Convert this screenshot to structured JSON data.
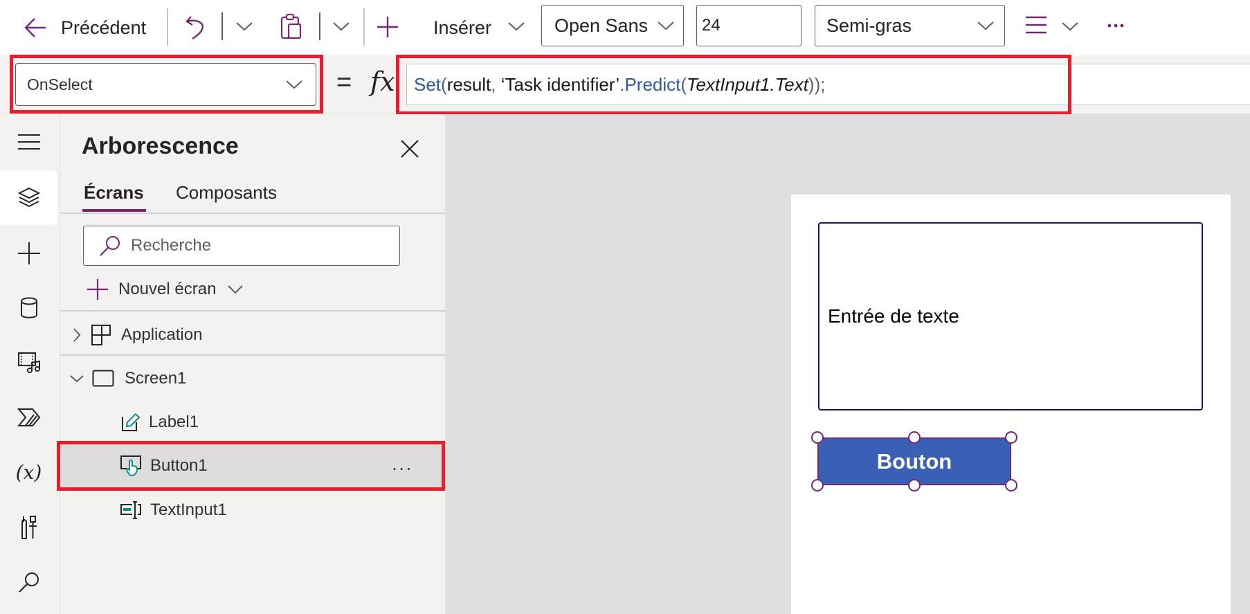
{
  "toolbar": {
    "back_label": "Précédent",
    "insert_label": "Insérer",
    "font_family": "Open Sans",
    "font_size": "24",
    "font_weight": "Semi-gras",
    "icons": {
      "back": "arrow-left-icon",
      "undo": "undo-icon",
      "paste": "clipboard-icon",
      "insert": "plus-icon",
      "align": "align-lines-icon",
      "more": "ellipsis-icon"
    }
  },
  "formula_bar": {
    "property": "OnSelect",
    "equals": "=",
    "fx": "fx",
    "formula_tokens": [
      {
        "text": "Set",
        "kind": "fn"
      },
      {
        "text": "(",
        "kind": "punct"
      },
      {
        "text": "result",
        "kind": "plain"
      },
      {
        "text": ", ",
        "kind": "punct"
      },
      {
        "text": "‘Task identifier’",
        "kind": "plain"
      },
      {
        "text": ".",
        "kind": "punct"
      },
      {
        "text": "Predict",
        "kind": "fn"
      },
      {
        "text": "(",
        "kind": "punct"
      },
      {
        "text": "TextInput1.Text",
        "kind": "param"
      },
      {
        "text": "));",
        "kind": "punct"
      }
    ],
    "formula_text": "Set(result, ‘Task identifier’.Predict(TextInput1.Text));"
  },
  "left_rail": {
    "items": [
      {
        "name": "menu",
        "icon": "hamburger-icon"
      },
      {
        "name": "tree-view",
        "icon": "layers-icon",
        "active": true
      },
      {
        "name": "insert",
        "icon": "plus-icon"
      },
      {
        "name": "data",
        "icon": "database-icon"
      },
      {
        "name": "media",
        "icon": "media-icon"
      },
      {
        "name": "power-automate",
        "icon": "power-automate-icon"
      },
      {
        "name": "variables",
        "icon": "variables-icon",
        "glyph": "(x)"
      },
      {
        "name": "advanced-tools",
        "icon": "tools-icon"
      },
      {
        "name": "search",
        "icon": "search-icon"
      }
    ]
  },
  "tree_panel": {
    "title": "Arborescence",
    "tabs": [
      {
        "label": "Écrans",
        "active": true
      },
      {
        "label": "Composants",
        "active": false
      }
    ],
    "search_placeholder": "Recherche",
    "new_screen_label": "Nouvel écran",
    "items": [
      {
        "label": "Application",
        "icon": "app-grid-icon",
        "expander": "chevron-right",
        "level": 0
      },
      {
        "label": "Screen1",
        "icon": "screen-icon",
        "expander": "chevron-down",
        "level": 0
      },
      {
        "label": "Label1",
        "icon": "label-edit-icon",
        "level": 1
      },
      {
        "label": "Button1",
        "icon": "button-touch-icon",
        "level": 1,
        "selected": true,
        "more": "..."
      },
      {
        "label": "TextInput1",
        "icon": "text-input-icon",
        "level": 1
      }
    ]
  },
  "canvas": {
    "text_input_value": "Entrée de texte",
    "button_label": "Bouton"
  },
  "colors": {
    "accent": "#742774",
    "highlight_red": "#e3202b",
    "button_blue": "#3a60b5",
    "formula_fn_blue": "#2e5aa0",
    "input_border_navy": "#15185a"
  }
}
